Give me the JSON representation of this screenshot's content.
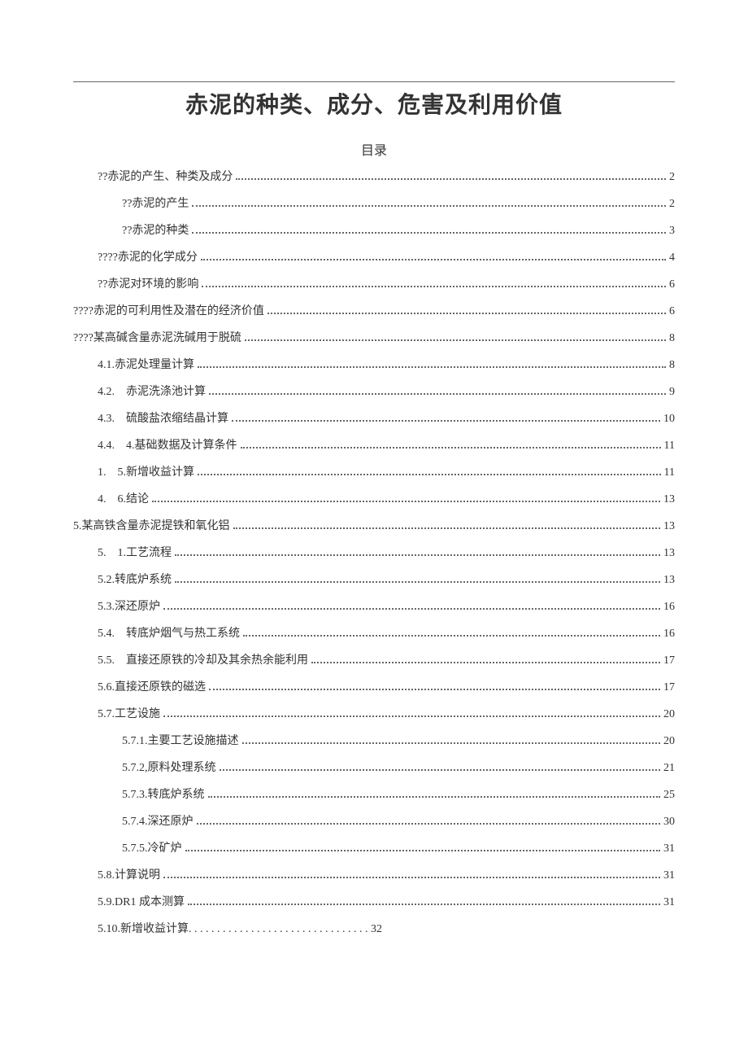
{
  "title": "赤泥的种类、成分、危害及利用价值",
  "toc_heading": "目录",
  "toc": [
    {
      "level": 1,
      "label": "??赤泥的产生、种类及成分",
      "page": "2"
    },
    {
      "level": 2,
      "label": "??赤泥的产生",
      "page": "2"
    },
    {
      "level": 2,
      "label": "??赤泥的种类",
      "page": "3"
    },
    {
      "level": 1,
      "label": "????赤泥的化学成分",
      "page": "4"
    },
    {
      "level": 1,
      "label": "??赤泥对环境的影响",
      "page": "6"
    },
    {
      "level": 0,
      "label": "????赤泥的可利用性及潜在的经济价值",
      "page": "6"
    },
    {
      "level": 0,
      "label": "????某高碱含量赤泥洗碱用于脱硫",
      "page": "8"
    },
    {
      "level": 1,
      "label": "4.1.赤泥处理量计算",
      "page": "8"
    },
    {
      "level": 1,
      "label": "4.2. 赤泥洗涤池计算",
      "page": "9"
    },
    {
      "level": 1,
      "label": "4.3. 硫酸盐浓缩结晶计算",
      "page": "10"
    },
    {
      "level": 1,
      "label": "4.4. 4.基础数据及计算条件",
      "page": "11"
    },
    {
      "level": 1,
      "label": "1. 5.新增收益计算",
      "page": "11"
    },
    {
      "level": 1,
      "label": "4. 6.结论",
      "page": "13"
    },
    {
      "level": 0,
      "label": "5.某高铁含量赤泥提铁和氧化铝",
      "page": "13"
    },
    {
      "level": 1,
      "label": "5. 1.工艺流程",
      "page": "13"
    },
    {
      "level": 1,
      "label": "5.2.转底炉系统",
      "page": "13"
    },
    {
      "level": 1,
      "label": "5.3.深还原炉",
      "page": "16"
    },
    {
      "level": 1,
      "label": "5.4. 转底炉烟气与热工系统",
      "page": "16"
    },
    {
      "level": 1,
      "label": "5.5. 直接还原铁的冷却及其余热余能利用",
      "page": "17"
    },
    {
      "level": 1,
      "label": "5.6.直接还原铁的磁选",
      "page": "17"
    },
    {
      "level": 1,
      "label": "5.7.工艺设施",
      "page": "20"
    },
    {
      "level": 2,
      "label": "5.7.1.主要工艺设施描述",
      "page": "20"
    },
    {
      "level": 2,
      "label": "5.7.2,原料处理系统",
      "page": "21"
    },
    {
      "level": 2,
      "label": "5.7.3.转底炉系统",
      "page": "25"
    },
    {
      "level": 2,
      "label": "5.7.4.深还原炉",
      "page": "30"
    },
    {
      "level": 2,
      "label": "5.7.5.冷矿炉",
      "page": "31"
    },
    {
      "level": 1,
      "label": "5.8.计算说明",
      "page": "31"
    },
    {
      "level": 1,
      "label": "5.9.DR1 成本测算",
      "page": "31"
    },
    {
      "level": 1,
      "label": "5.10.新增收益计算. . . . . . . . . . . . . . . . . . . . . . . . . . . . . . . . 32",
      "page": ""
    }
  ]
}
